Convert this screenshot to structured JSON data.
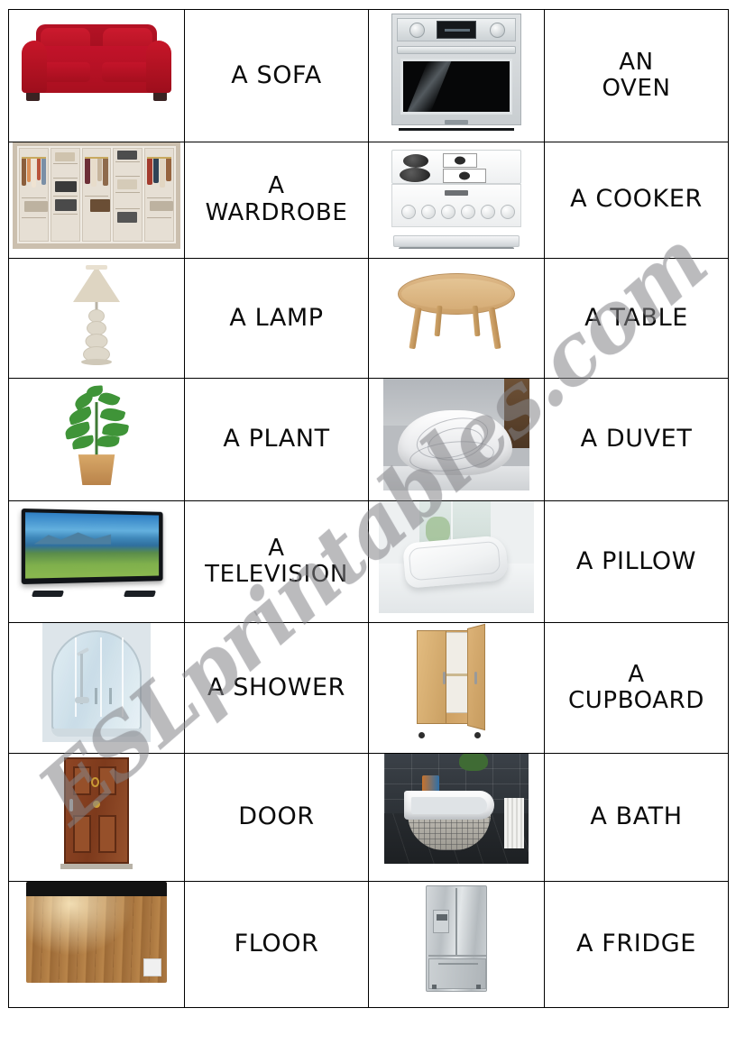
{
  "document": {
    "title": "Household Objects Matching Cards",
    "watermark": "ESLprintables.com",
    "watermark_color": "#87878c",
    "columns": 4,
    "rows": 8
  },
  "rows": [
    {
      "left": {
        "image": "red-sofa-photo",
        "word": "A SOFA"
      },
      "right": {
        "image": "wall-oven-photo",
        "word": "AN\nOVEN"
      }
    },
    {
      "left": {
        "image": "wardrobe-closet-photo",
        "word": "A\nWARDROBE"
      },
      "right": {
        "image": "white-cooker-photo",
        "word": "A COOKER"
      }
    },
    {
      "left": {
        "image": "table-lamp-photo",
        "word": "A LAMP"
      },
      "right": {
        "image": "round-table-photo",
        "word": "A TABLE"
      }
    },
    {
      "left": {
        "image": "potted-plant-photo",
        "word": "A PLANT"
      },
      "right": {
        "image": "folded-duvet-photo",
        "word": "A DUVET"
      }
    },
    {
      "left": {
        "image": "flatscreen-tv-photo",
        "word": "A\nTELEVISION"
      },
      "right": {
        "image": "white-pillow-photo",
        "word": "A PILLOW"
      }
    },
    {
      "left": {
        "image": "shower-cubicle-photo",
        "word": "A SHOWER"
      },
      "right": {
        "image": "wooden-cupboard-photo",
        "word": "A\nCUPBOARD"
      }
    },
    {
      "left": {
        "image": "wooden-door-photo",
        "word": "DOOR"
      },
      "right": {
        "image": "bathtub-photo",
        "word": "A BATH"
      }
    },
    {
      "left": {
        "image": "wood-floor-photo",
        "word": "FLOOR"
      },
      "right": {
        "image": "fridge-freezer-photo",
        "word": "A FRIDGE"
      }
    }
  ]
}
